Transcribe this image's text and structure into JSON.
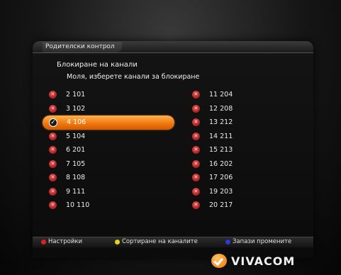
{
  "window": {
    "title": "Родителски контрол"
  },
  "main": {
    "heading": "Блокиране на канали",
    "subheading": "Моля, изберете канали за блокиране"
  },
  "channels_left": [
    {
      "label": "2 101",
      "state": "blocked"
    },
    {
      "label": "3 102",
      "state": "blocked"
    },
    {
      "label": "4 106",
      "state": "selected"
    },
    {
      "label": "5 104",
      "state": "blocked"
    },
    {
      "label": "6 201",
      "state": "blocked"
    },
    {
      "label": "7 105",
      "state": "blocked"
    },
    {
      "label": "8 108",
      "state": "blocked"
    },
    {
      "label": "9 111",
      "state": "blocked"
    },
    {
      "label": "10 110",
      "state": "blocked"
    }
  ],
  "channels_right": [
    {
      "label": "11 204",
      "state": "blocked"
    },
    {
      "label": "12 208",
      "state": "blocked"
    },
    {
      "label": "13 212",
      "state": "blocked"
    },
    {
      "label": "14 211",
      "state": "blocked"
    },
    {
      "label": "15 213",
      "state": "blocked"
    },
    {
      "label": "16 202",
      "state": "blocked"
    },
    {
      "label": "17 206",
      "state": "blocked"
    },
    {
      "label": "19 203",
      "state": "blocked"
    },
    {
      "label": "20 217",
      "state": "blocked"
    }
  ],
  "footer": {
    "hints": [
      {
        "label": "Настройки",
        "color": "#e02020"
      },
      {
        "label": "Сортиране на каналите",
        "color": "#e6d21a"
      },
      {
        "label": "Запази промените",
        "color": "#2a3bd6"
      }
    ]
  },
  "brand": {
    "name": "VIVACOM",
    "accent": "#f08c1f"
  }
}
